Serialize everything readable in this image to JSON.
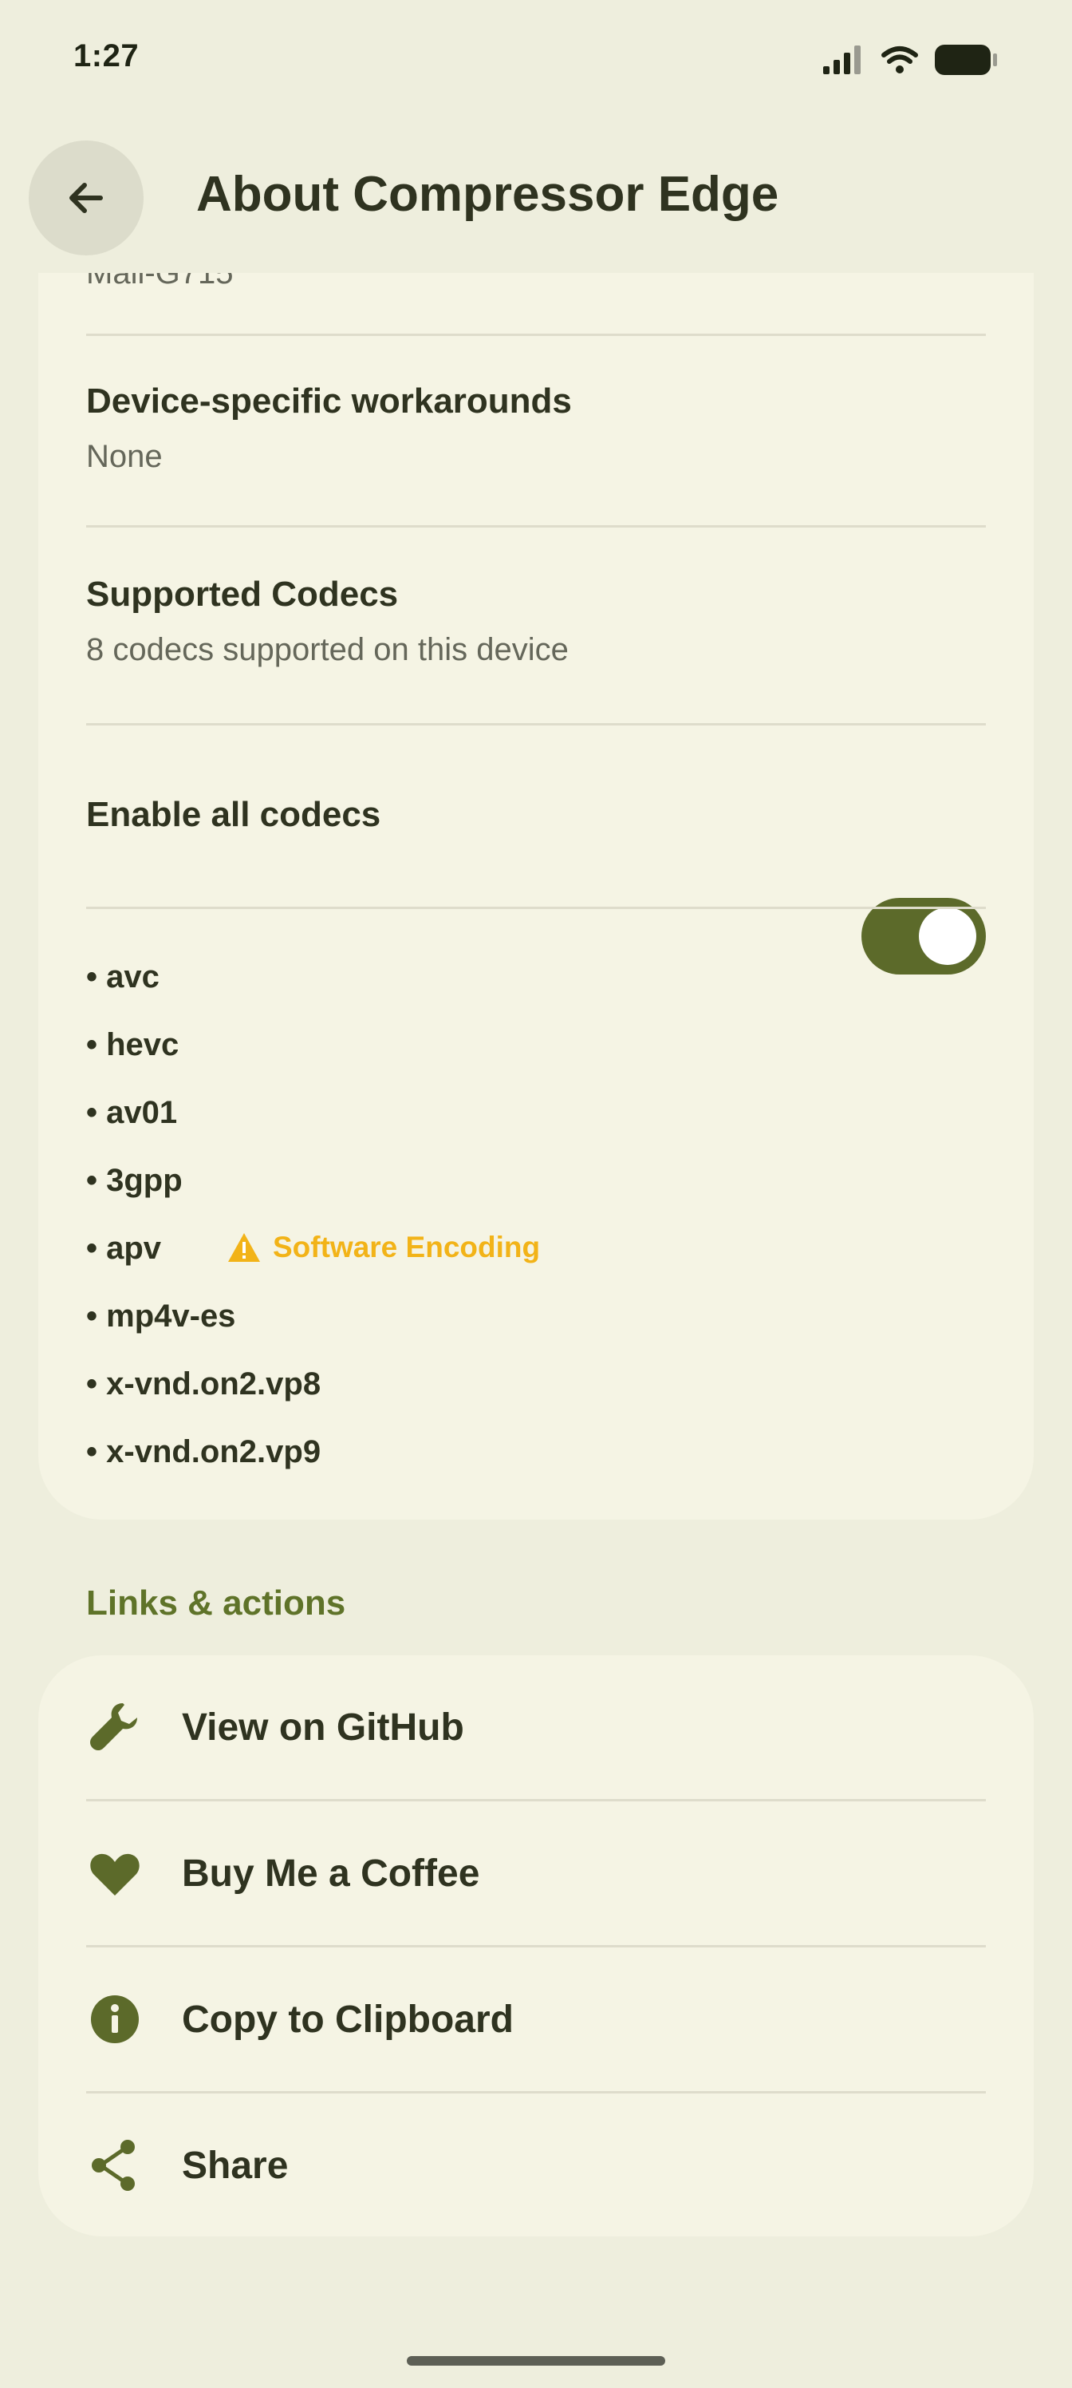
{
  "status_bar": {
    "time": "1:27"
  },
  "app_bar": {
    "title": "About Compressor Edge",
    "back_icon": "arrow-left-icon"
  },
  "device_info": {
    "clipped_model": "Mali-G715",
    "workarounds": {
      "title": "Device-specific workarounds",
      "value": "None"
    },
    "codecs": {
      "title": "Supported Codecs",
      "subtitle": "8 codecs supported on this device",
      "enable_all_label": "Enable all codecs",
      "enable_all_on": true,
      "list": [
        "avc",
        "hevc",
        "av01",
        "3gpp",
        "apv",
        "mp4v-es",
        "x-vnd.on2.vp8",
        "x-vnd.on2.vp9"
      ],
      "apv_warning": "Software Encoding"
    }
  },
  "links_section": {
    "label": "Links & actions",
    "items": [
      {
        "label": "View on GitHub",
        "icon": "wrench-icon"
      },
      {
        "label": "Buy Me a Coffee",
        "icon": "heart-icon"
      },
      {
        "label": "Copy to Clipboard",
        "icon": "info-icon"
      },
      {
        "label": "Share",
        "icon": "share-icon"
      }
    ]
  },
  "colors": {
    "background": "#eeeedd",
    "card": "#f5f4e4",
    "accent": "#5c6a2a",
    "warning": "#f2b318"
  }
}
